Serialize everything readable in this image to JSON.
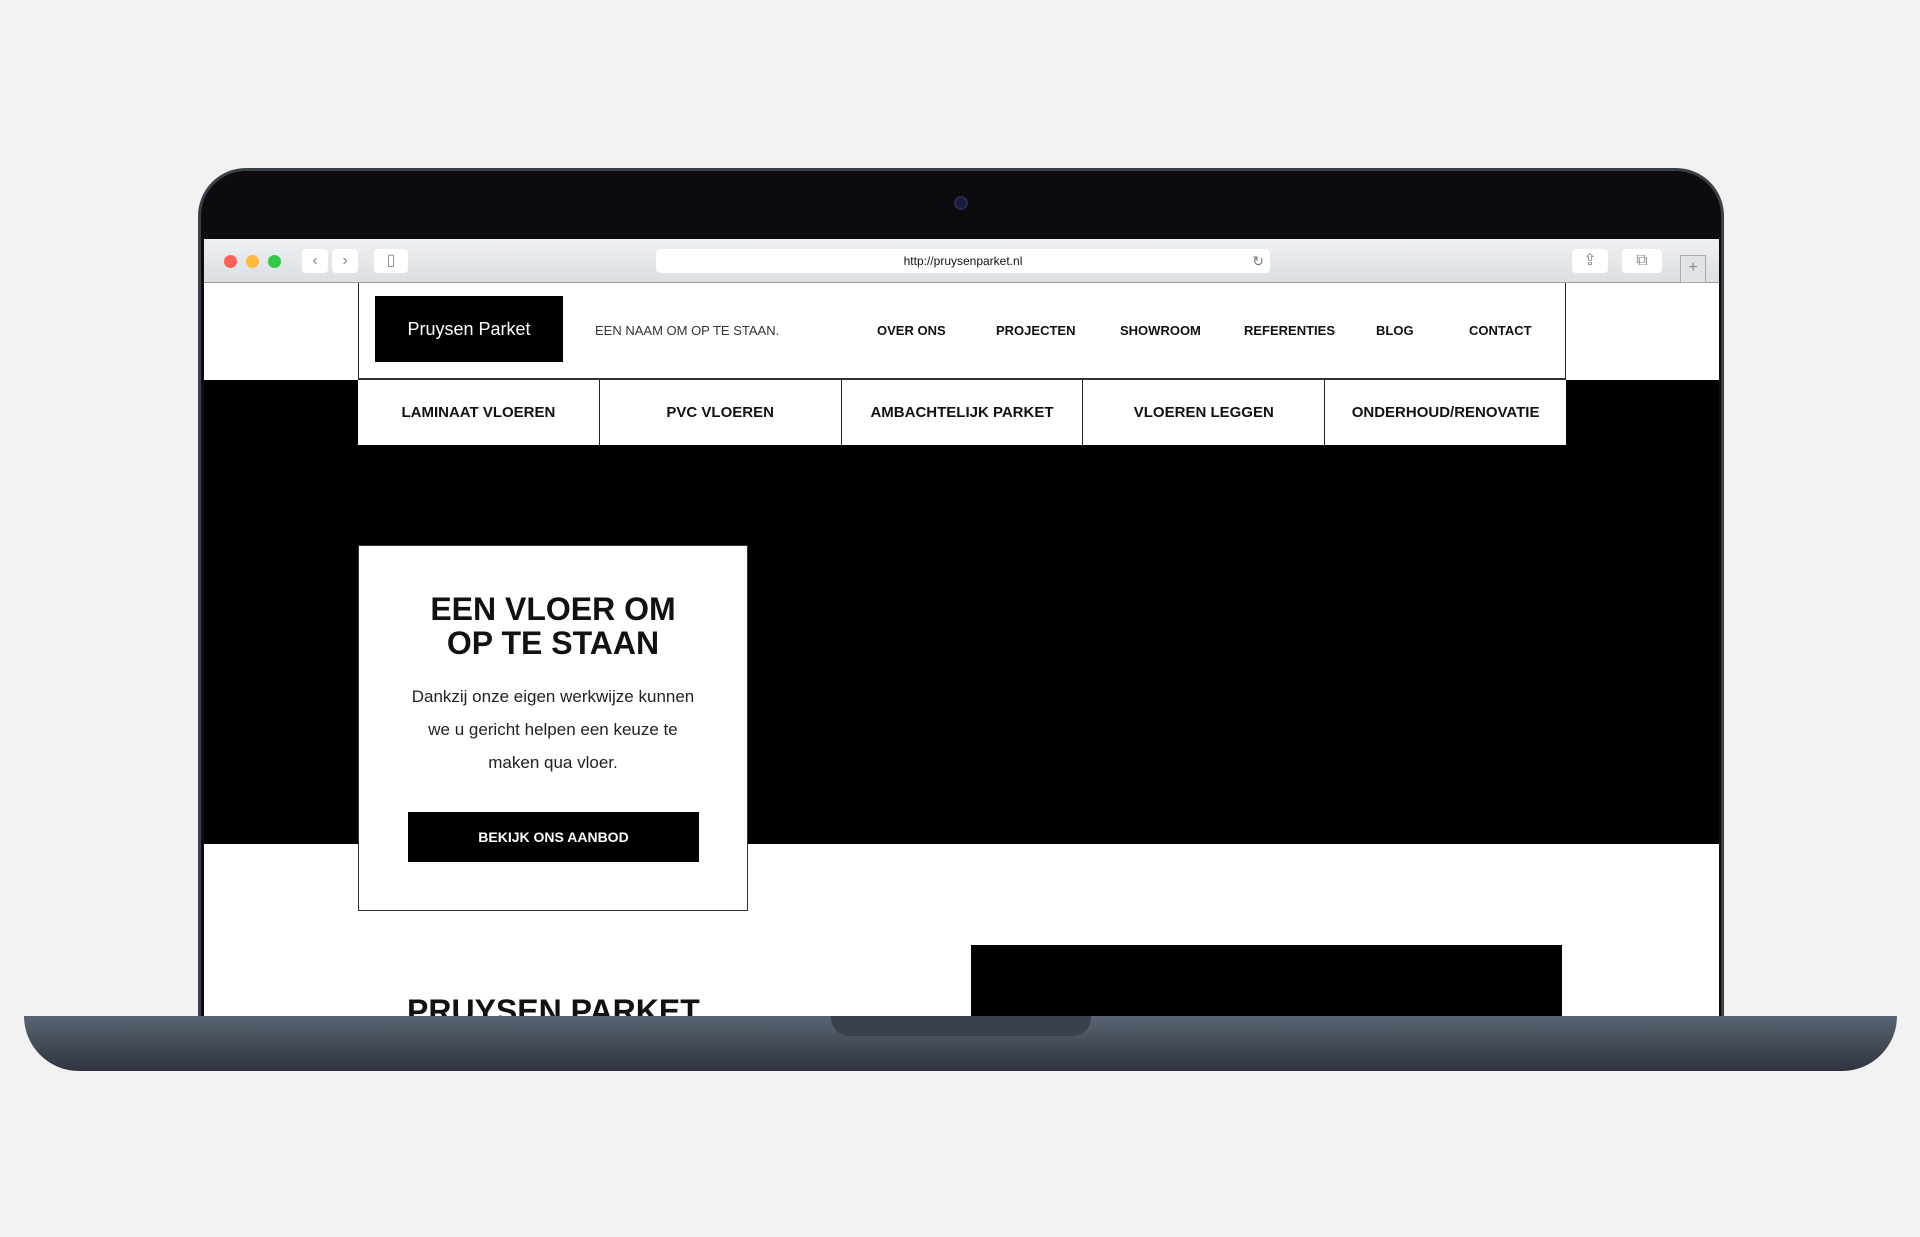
{
  "browser": {
    "url": "http://pruysenparket.nl",
    "icons": [
      "close-dot",
      "minimize-dot",
      "zoom-dot",
      "back-icon",
      "forward-icon",
      "sidebar-icon",
      "reload-icon",
      "share-icon",
      "tabs-icon",
      "new-tab-icon"
    ]
  },
  "header": {
    "logo": "Pruysen Parket",
    "tagline": "EEN NAAM OM OP TE STAAN.",
    "nav": [
      "OVER ONS",
      "PROJECTEN",
      "SHOWROOM",
      "REFERENTIES",
      "BLOG",
      "CONTACT"
    ]
  },
  "subnav": [
    "LAMINAAT VLOEREN",
    "PVC VLOEREN",
    "AMBACHTELIJK PARKET",
    "VLOEREN LEGGEN",
    "ONDERHOUD/RENOVATIE"
  ],
  "hero": {
    "title_line1": "EEN VLOER OM",
    "title_line2": "OP TE STAAN",
    "text": "Dankzij onze eigen werkwijze kunnen we u gericht helpen een keuze te maken qua vloer.",
    "cta": "BEKIJK ONS AANBOD"
  },
  "section": {
    "title": "PRUYSEN PARKET"
  }
}
